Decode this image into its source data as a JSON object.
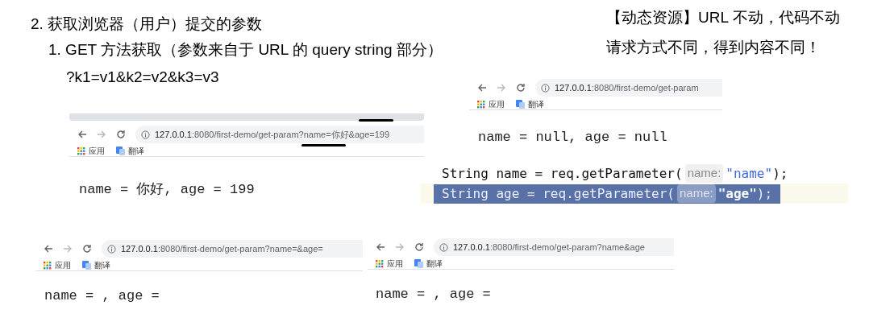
{
  "heading": "2. 获取浏览器（用户）提交的参数",
  "subheading": "1. GET 方法获取（参数来自于 URL 的 query string 部分）",
  "example": "?k1=v1&k2=v2&k3=v3",
  "note": [
    "【动态资源】URL 不动，代码不动",
    "请求方式不同，得到内容不同！"
  ],
  "browsers": [
    {
      "host": "127.0.0.1",
      "path": ":8080/first-demo/get-param?name=你好&age=199",
      "bookmarks": [
        "应用",
        "翻译"
      ],
      "output": "name = 你好, age = 199",
      "marked": true
    },
    {
      "host": "127.0.0.1",
      "path": ":8080/first-demo/get-param",
      "bookmarks": [
        "应用",
        "翻译"
      ],
      "output": "name = null, age = null",
      "marked": false
    },
    {
      "host": "127.0.0.1",
      "path": ":8080/first-demo/get-param?name=&age=",
      "bookmarks": [
        "应用",
        "翻译"
      ],
      "output": "name = , age =",
      "marked": false
    },
    {
      "host": "127.0.0.1",
      "path": ":8080/first-demo/get-param?name&age",
      "bookmarks": [
        "应用",
        "翻译"
      ],
      "output": "name = , age =",
      "marked": false
    }
  ],
  "code_lines": [
    {
      "selected": false,
      "tokens": [
        {
          "kind": "code",
          "text": "String name = req.getParameter("
        },
        {
          "kind": "hint",
          "text": "name:"
        },
        {
          "kind": "string",
          "text": "\"name\""
        },
        {
          "kind": "code",
          "text": ");"
        }
      ]
    },
    {
      "selected": true,
      "tokens": [
        {
          "kind": "code",
          "text": "String age = req.getParameter("
        },
        {
          "kind": "hint",
          "text": "name:"
        },
        {
          "kind": "string",
          "text": "\"age\""
        },
        {
          "kind": "code",
          "text": ");"
        }
      ]
    }
  ]
}
